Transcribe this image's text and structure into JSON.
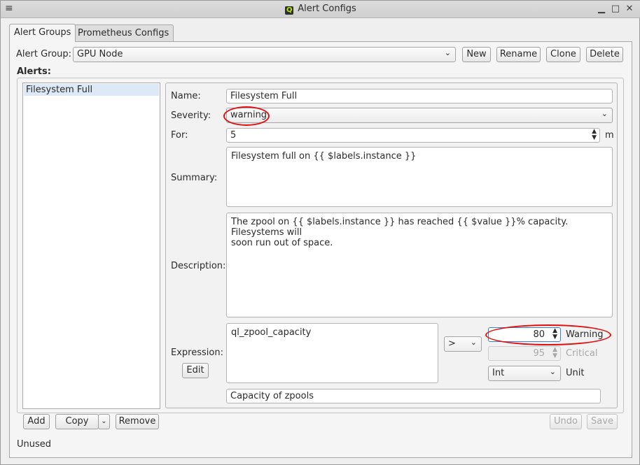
{
  "window": {
    "title": "Alert Configs",
    "menu_icon": "≡",
    "minimize_icon": "▁",
    "maximize_icon": "□",
    "close_icon": "✕"
  },
  "tabs": [
    "Alert Groups",
    "Prometheus Configs"
  ],
  "group_bar": {
    "label": "Alert Group:",
    "selected": "GPU Node",
    "buttons": {
      "new": "New",
      "rename": "Rename",
      "clone": "Clone",
      "delete": "Delete"
    }
  },
  "alerts_label": "Alerts:",
  "alerts_list": [
    "Filesystem Full"
  ],
  "form": {
    "name_label": "Name:",
    "name_value": "Filesystem Full",
    "severity_label": "Severity:",
    "severity_value": "warning",
    "for_label": "For:",
    "for_value": "5",
    "for_unit": "m",
    "summary_label": "Summary:",
    "summary_value": "Filesystem full on {{ $labels.instance }}",
    "description_label": "Description:",
    "description_value": "The zpool on {{ $labels.instance }} has reached {{ $value }}% capacity. Filesystems will\nsoon run out of space.",
    "expression_label": "Expression:",
    "expression_edit": "Edit",
    "expression_value": "ql_zpool_capacity",
    "operator": ">",
    "warning_value": "80",
    "warning_label": "Warning",
    "critical_value": "95",
    "critical_label": "Critical",
    "type_value": "Int",
    "unit_label": "Unit",
    "expression_desc": "Capacity of zpools"
  },
  "bottom": {
    "add": "Add",
    "copy": "Copy",
    "remove": "Remove",
    "undo": "Undo",
    "save": "Save"
  },
  "status": "Unused",
  "colors": {
    "highlight_circle": "#e01010",
    "selection": "#dde9f6",
    "app_icon_accent": "#b6f000"
  }
}
